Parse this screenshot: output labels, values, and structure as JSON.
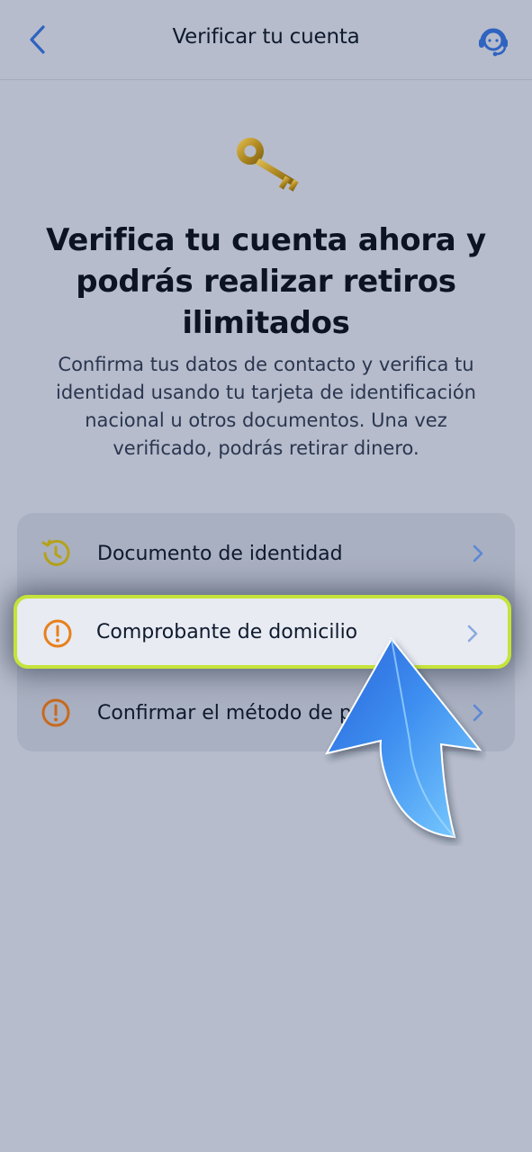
{
  "header": {
    "title": "Verificar tu cuenta",
    "back_icon": "chevron-left-icon",
    "support_icon": "headset-icon"
  },
  "hero": {
    "icon": "key-icon",
    "headline": "Verifica tu cuenta ahora y podrás realizar retiros ilimitados",
    "description": "Confirma tus datos de contacto y verifica tu identidad usando tu tarjeta de identificación nacional u otros documentos. Una vez verificado, podrás retirar dinero."
  },
  "steps": [
    {
      "label": "Documento de identidad",
      "status_icon": "clock-pending-icon",
      "status_color": "#b5a21a"
    },
    {
      "label": "Comprobante de domicilio",
      "status_icon": "exclamation-circle-icon",
      "status_color": "#e8801c"
    },
    {
      "label": "Confirmar el método de pa",
      "status_icon": "exclamation-circle-icon",
      "status_color": "#c86a1e"
    }
  ],
  "colors": {
    "background": "#b6bccb",
    "accent": "#2f63c0",
    "highlight_border": "#c5e33a",
    "pointer_arrow": "#3d8ef0"
  },
  "overlay": {
    "pointer_icon": "pointer-arrow-icon"
  }
}
